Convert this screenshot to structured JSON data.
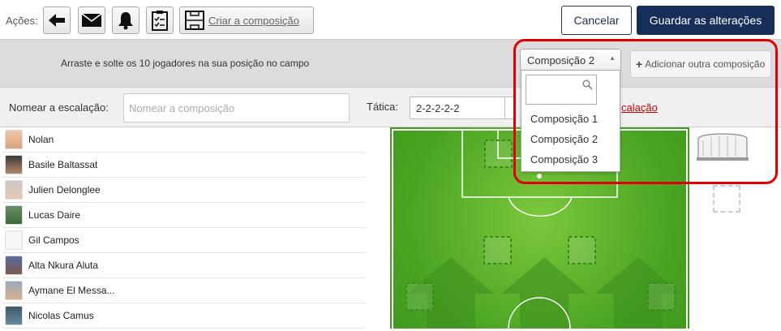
{
  "toolbar": {
    "acoes_label": "Ações:",
    "icons": [
      "back-arrow-icon",
      "mail-icon",
      "bell-icon",
      "clipboard-checklist-icon",
      "field-icon"
    ],
    "criar_label": "Criar a composição",
    "cancel_label": "Cancelar",
    "save_label": "Guardar as alterações"
  },
  "instructions": "Arraste e solte os 10 jogadores na sua posição no campo",
  "composition": {
    "selected": "Composição 2",
    "add_label": "Adicionar outra composição",
    "options": [
      "Composição 1",
      "Composição 2",
      "Composição 3"
    ],
    "search_value": ""
  },
  "form": {
    "name_label": "Nomear a escalação:",
    "name_placeholder": "Nomear a composição",
    "tactic_label": "Tática:",
    "tactic_value": "2-2-2-2-2",
    "escalacao_link": "calação"
  },
  "players": [
    {
      "name": "Nolan"
    },
    {
      "name": "Basile Baltassat"
    },
    {
      "name": "Julien Delonglee"
    },
    {
      "name": "Lucas Daire"
    },
    {
      "name": "Gil Campos"
    },
    {
      "name": "Alta Nkura Aluta"
    },
    {
      "name": "Aymane El Messa..."
    },
    {
      "name": "Nicolas Camus"
    }
  ],
  "colors": {
    "primary": "#172e58",
    "highlight": "#e10000",
    "link": "#cc0000",
    "pitch": "#4aa422"
  }
}
